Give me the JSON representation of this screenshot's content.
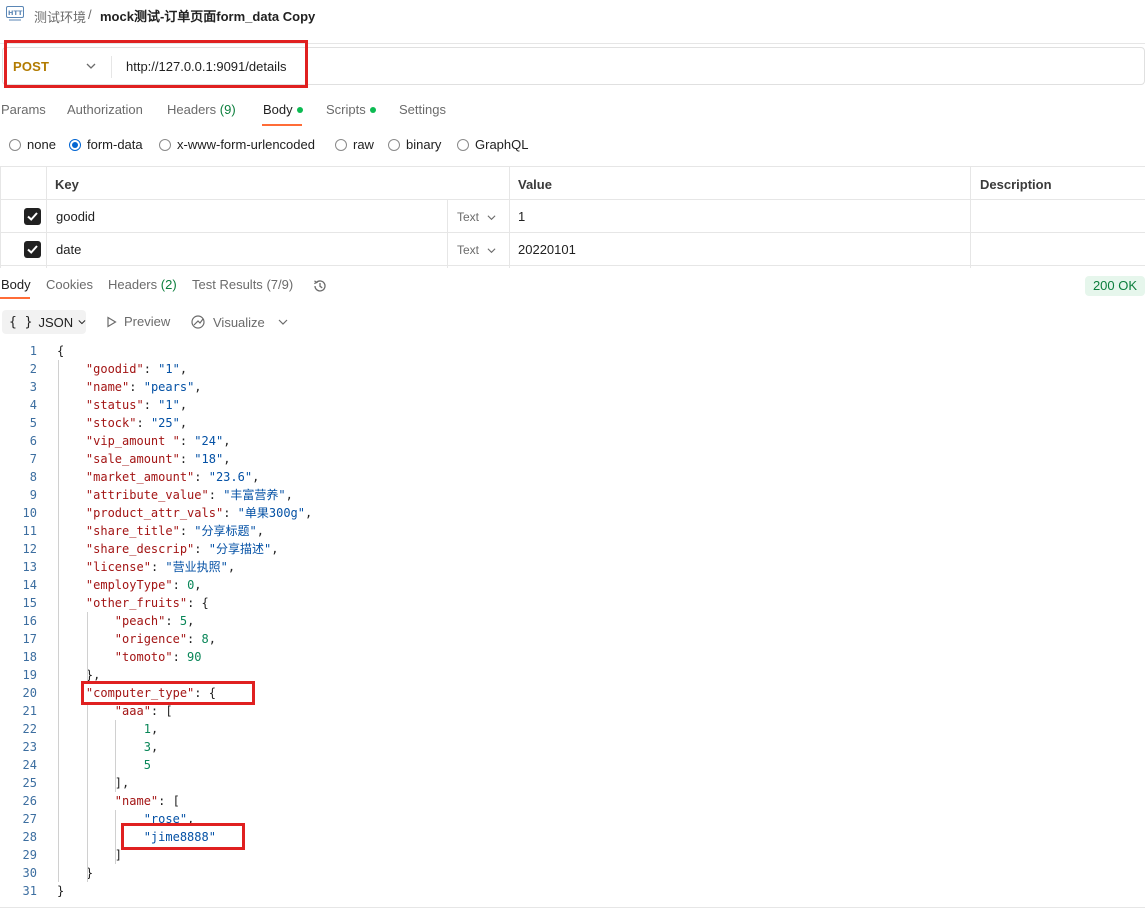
{
  "header": {
    "workspace": "测试环境",
    "separator": "/",
    "title": "mock测试-订单页面form_data Copy"
  },
  "request": {
    "method": "POST",
    "url": "http://127.0.0.1:9091/details"
  },
  "request_tabs": [
    {
      "label": "Params"
    },
    {
      "label": "Authorization"
    },
    {
      "label": "Headers",
      "count": "(9)"
    },
    {
      "label": "Body",
      "dot": true
    },
    {
      "label": "Scripts",
      "dot": true
    },
    {
      "label": "Settings"
    }
  ],
  "body_modes": {
    "options": [
      "none",
      "form-data",
      "x-www-form-urlencoded",
      "raw",
      "binary",
      "GraphQL"
    ],
    "selected": "form-data"
  },
  "params_table": {
    "headers": [
      "Key",
      "Value",
      "Description"
    ],
    "rows": [
      {
        "checked": true,
        "key": "goodid",
        "type": "Text",
        "value": "1",
        "description": ""
      },
      {
        "checked": true,
        "key": "date",
        "type": "Text",
        "value": "20220101",
        "description": ""
      }
    ]
  },
  "response_tabs": [
    {
      "label": "Body"
    },
    {
      "label": "Cookies"
    },
    {
      "label": "Headers",
      "count": "(2)"
    },
    {
      "label": "Test Results",
      "count": "(7/9)"
    }
  ],
  "status": "200 OK",
  "toolbar": {
    "format": "JSON",
    "braces": "{ }",
    "preview": "Preview",
    "visualize": "Visualize"
  },
  "code_lines": [
    {
      "n": "1",
      "t": "{"
    },
    {
      "n": "2",
      "t": "    \"goodid\": \"1\","
    },
    {
      "n": "3",
      "t": "    \"name\": \"pears\","
    },
    {
      "n": "4",
      "t": "    \"status\": \"1\","
    },
    {
      "n": "5",
      "t": "    \"stock\": \"25\","
    },
    {
      "n": "6",
      "t": "    \"vip_amount \": \"24\","
    },
    {
      "n": "7",
      "t": "    \"sale_amount\": \"18\","
    },
    {
      "n": "8",
      "t": "    \"market_amount\": \"23.6\","
    },
    {
      "n": "9",
      "t": "    \"attribute_value\": \"丰富营养\","
    },
    {
      "n": "10",
      "t": "    \"product_attr_vals\": \"单果300g\","
    },
    {
      "n": "11",
      "t": "    \"share_title\": \"分享标题\","
    },
    {
      "n": "12",
      "t": "    \"share_descrip\": \"分享描述\","
    },
    {
      "n": "13",
      "t": "    \"license\": \"营业执照\","
    },
    {
      "n": "14",
      "t": "    \"employType\": 0,"
    },
    {
      "n": "15",
      "t": "    \"other_fruits\": {"
    },
    {
      "n": "16",
      "t": "        \"peach\": 5,"
    },
    {
      "n": "17",
      "t": "        \"origence\": 8,"
    },
    {
      "n": "18",
      "t": "        \"tomoto\": 90"
    },
    {
      "n": "19",
      "t": "    },"
    },
    {
      "n": "20",
      "t": "    \"computer_type\": {"
    },
    {
      "n": "21",
      "t": "        \"aaa\": ["
    },
    {
      "n": "22",
      "t": "            1,"
    },
    {
      "n": "23",
      "t": "            3,"
    },
    {
      "n": "24",
      "t": "            5"
    },
    {
      "n": "25",
      "t": "        ],"
    },
    {
      "n": "26",
      "t": "        \"name\": ["
    },
    {
      "n": "27",
      "t": "            \"rose\","
    },
    {
      "n": "28",
      "t": "            \"jime8888\""
    },
    {
      "n": "29",
      "t": "        ]"
    },
    {
      "n": "30",
      "t": "    }"
    },
    {
      "n": "31",
      "t": "}"
    }
  ],
  "colors": {
    "method": "#b27b00",
    "accent_underline": "#ff6c37",
    "highlight_box": "#e02020",
    "json_key": "#a31515",
    "json_string": "#0451a5",
    "json_number": "#098658",
    "status_ok": "#0b7e3c"
  }
}
